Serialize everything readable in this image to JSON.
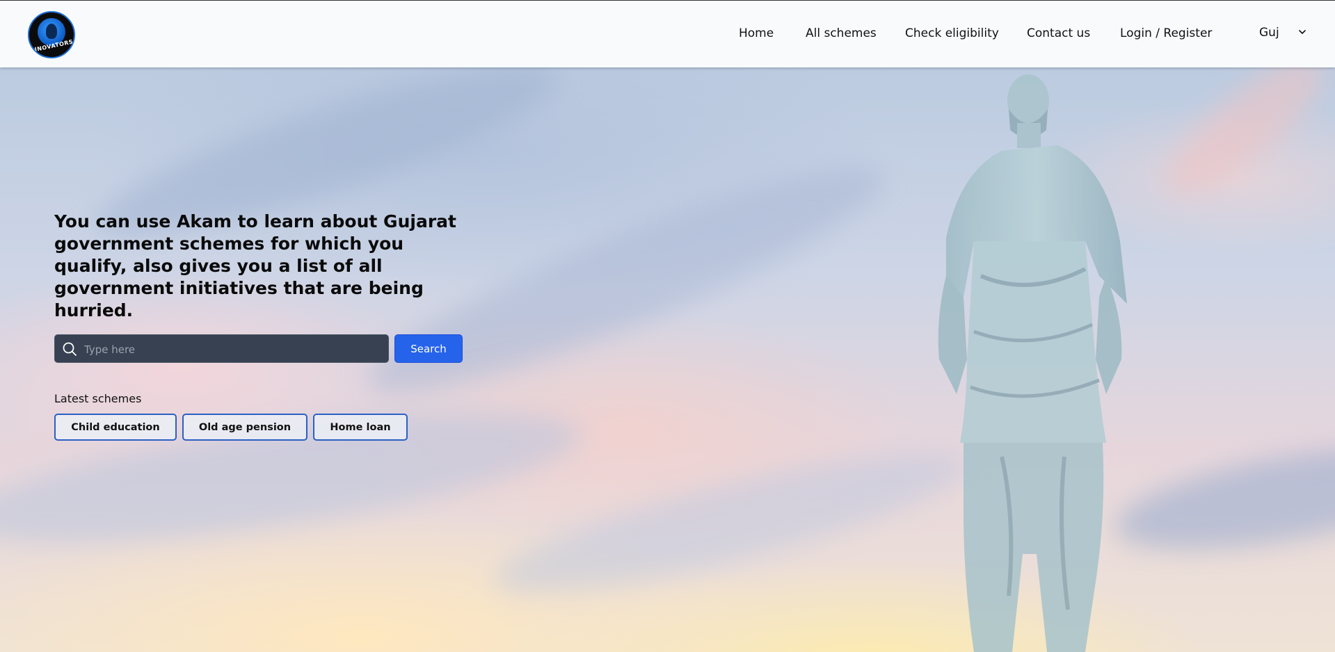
{
  "header": {
    "logo_text": "INNOVATORS",
    "nav": [
      {
        "label": "Home"
      },
      {
        "label": "All schemes"
      },
      {
        "label": "Check eligibility"
      },
      {
        "label": "Contact us"
      },
      {
        "label": "Login / Register"
      }
    ],
    "language": {
      "selected": "Guj"
    }
  },
  "hero": {
    "headline": "You can use Akam to learn about Gujarat government schemes for which you qualify, also gives you a list of all government initiatives that are being hurried.",
    "search": {
      "placeholder": "Type here",
      "value": "",
      "button_label": "Search"
    },
    "latest": {
      "label": "Latest schemes",
      "chips": [
        {
          "label": "Child education"
        },
        {
          "label": "Old age pension"
        },
        {
          "label": "Home loan"
        }
      ]
    }
  },
  "colors": {
    "header_bg": "#f8fafc",
    "search_bg": "#374151",
    "primary_button": "#2563eb",
    "chip_border": "#2b5fc4"
  },
  "icons": {
    "logo": "innovators-logo",
    "search": "search-icon",
    "chevron": "chevron-down-icon"
  }
}
